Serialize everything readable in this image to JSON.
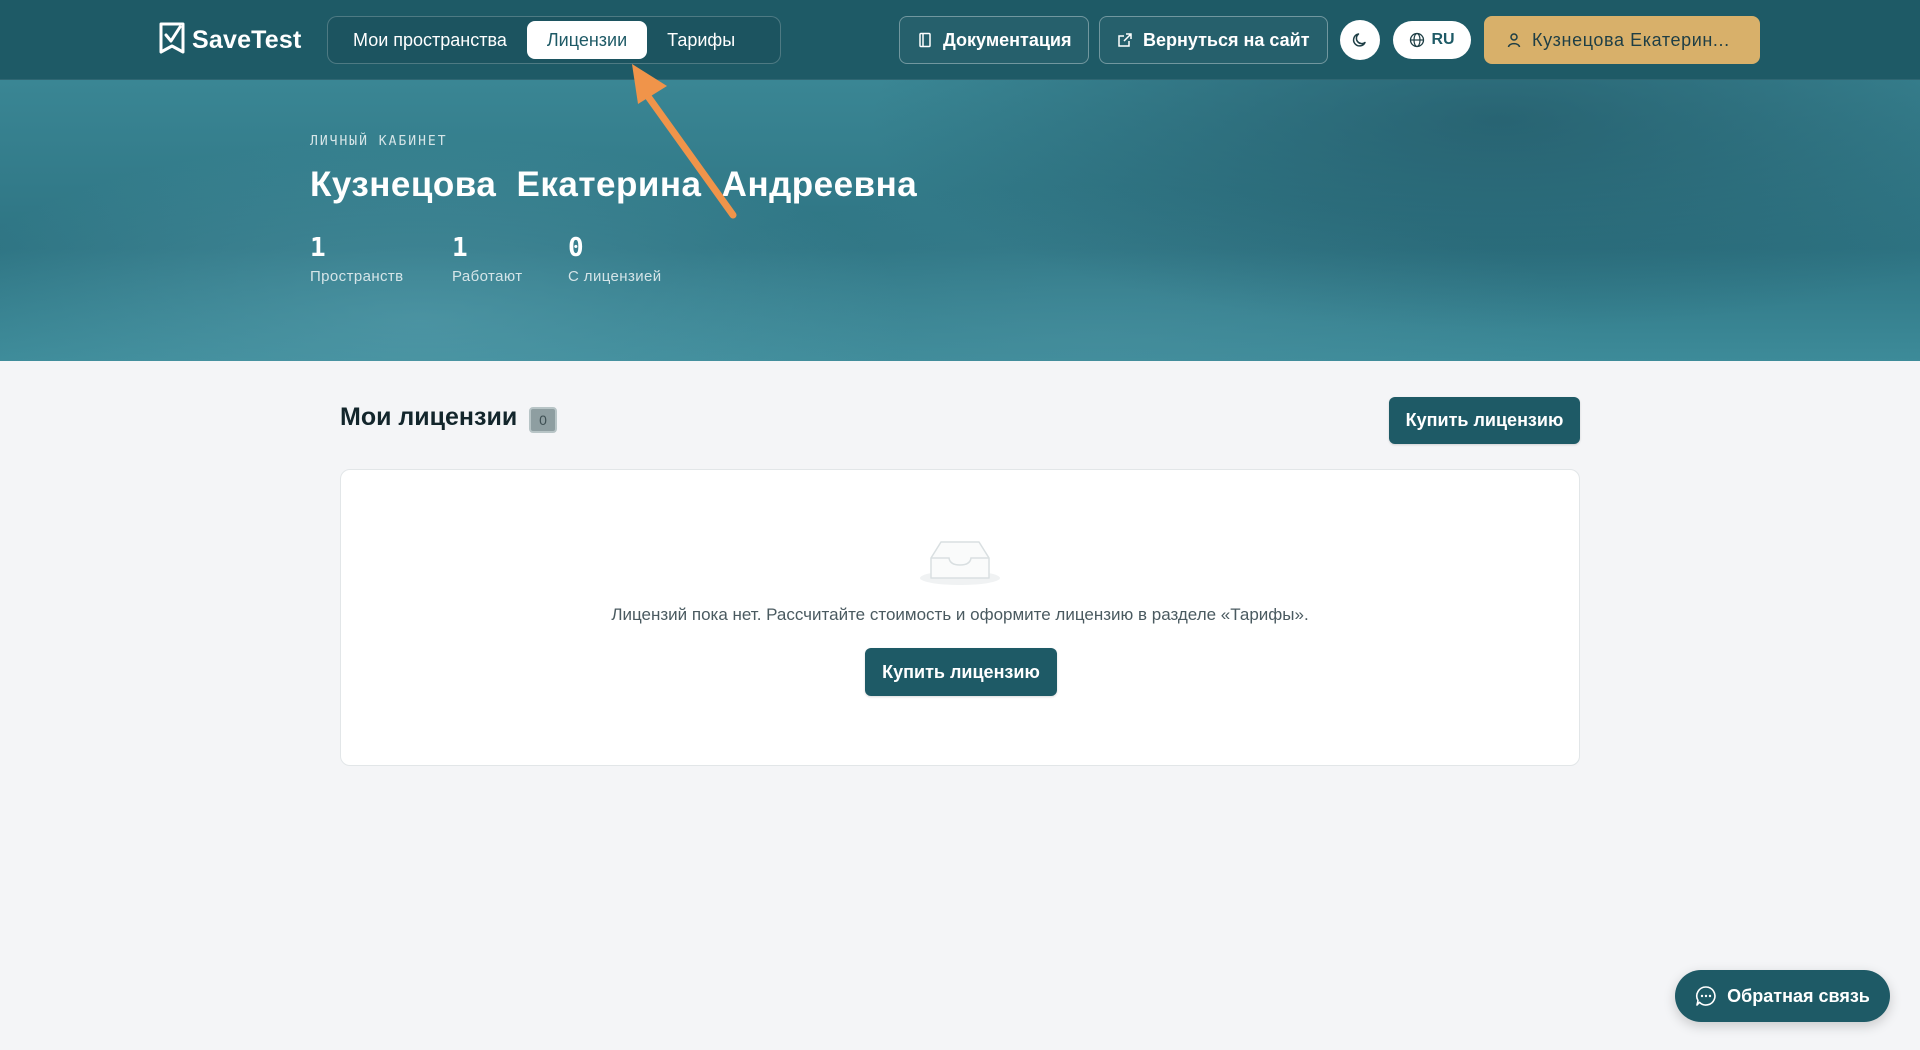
{
  "header": {
    "logo_text": "SaveTest",
    "nav": [
      {
        "label": "Мои пространства",
        "active": false
      },
      {
        "label": "Лицензии",
        "active": true
      },
      {
        "label": "Тарифы",
        "active": false
      }
    ],
    "docs_label": "Документация",
    "back_label": "Вернуться на сайт",
    "language": "RU",
    "user_label": "Кузнецова Екатерин..."
  },
  "hero": {
    "eyebrow": "ЛИЧНЫЙ КАБИНЕТ",
    "full_name": "Кузнецова Екатерина Андреевна",
    "stats": [
      {
        "value": "1",
        "label": "Пространств"
      },
      {
        "value": "1",
        "label": "Работают"
      },
      {
        "value": "0",
        "label": "С лицензией"
      }
    ]
  },
  "licenses": {
    "title": "Мои лицензии",
    "count": "0",
    "buy_label": "Купить лицензию",
    "empty_text": "Лицензий пока нет. Рассчитайте стоимость и оформите лицензию в разделе «Тарифы».",
    "empty_buy_label": "Купить лицензию"
  },
  "feedback": {
    "label": "Обратная связь"
  },
  "colors": {
    "primary": "#1e5a66",
    "accent_gold": "#d8b06a",
    "annotation_arrow": "#f0944a",
    "page_bg": "#f4f5f7"
  }
}
